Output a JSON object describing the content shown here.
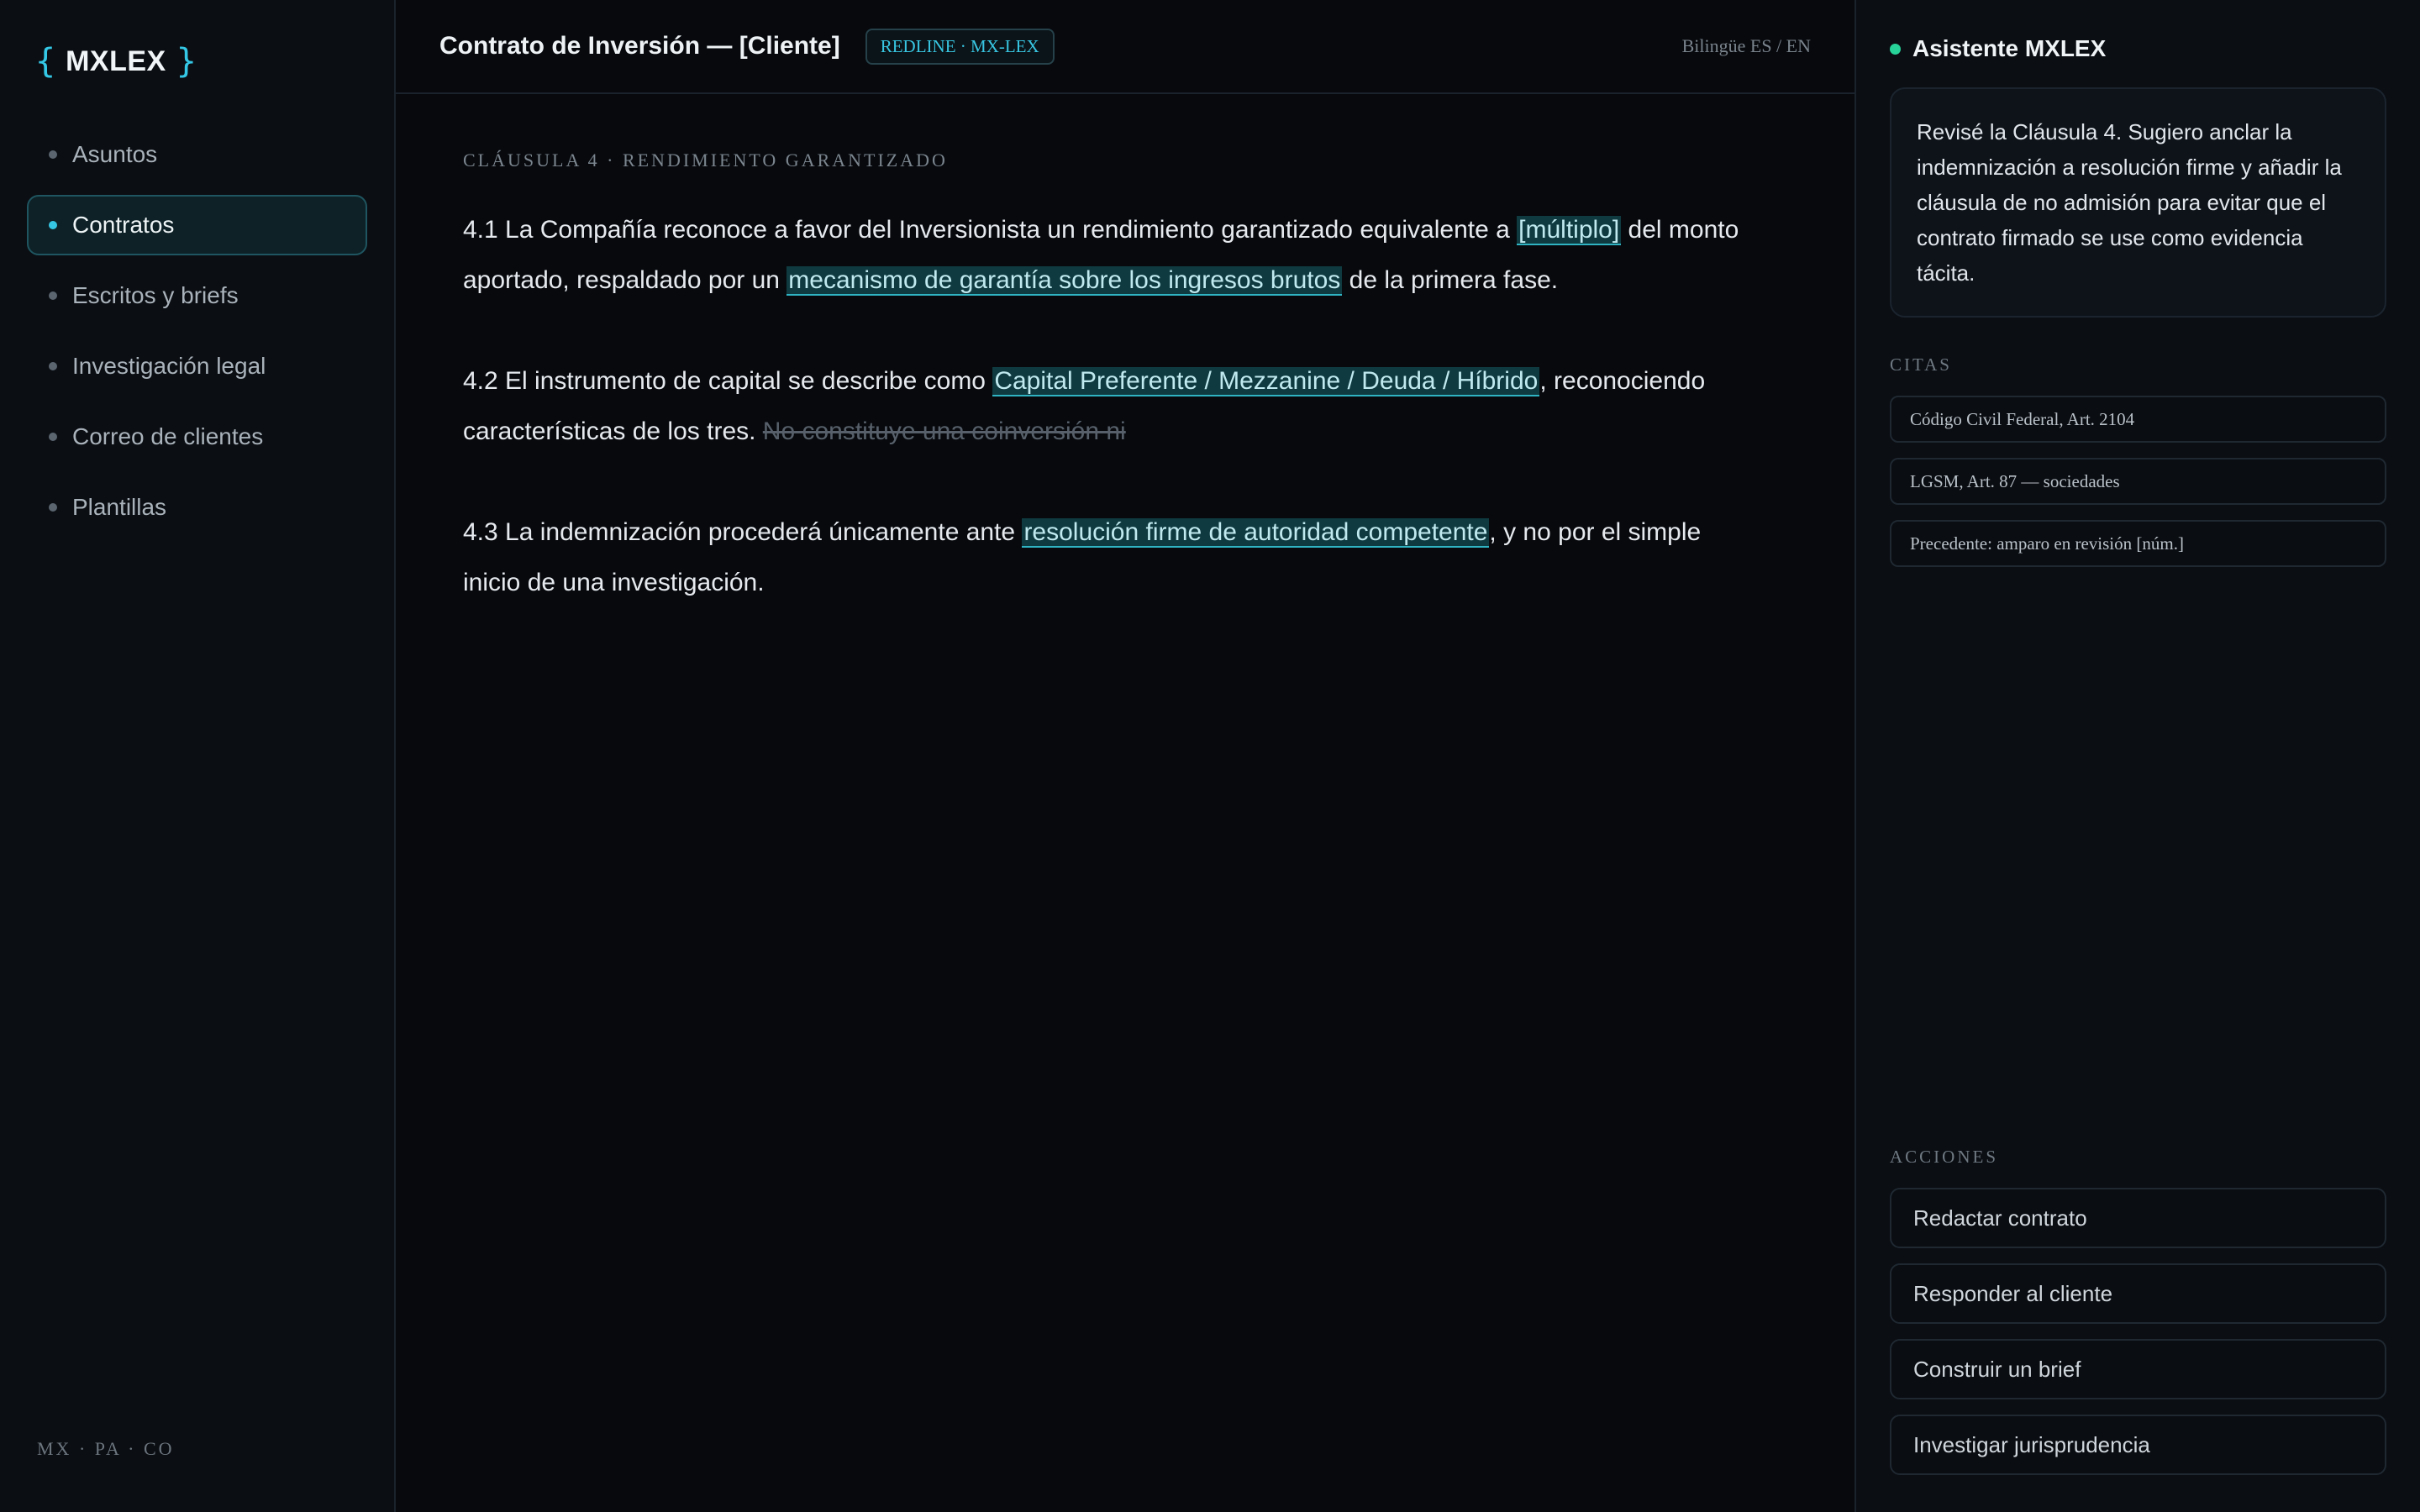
{
  "brand": {
    "left_brace": "{",
    "name": "MXLEX",
    "right_brace": "}"
  },
  "sidebar": {
    "items": [
      {
        "label": "Asuntos",
        "active": false
      },
      {
        "label": "Contratos",
        "active": true
      },
      {
        "label": "Escritos y briefs",
        "active": false
      },
      {
        "label": "Investigación legal",
        "active": false
      },
      {
        "label": "Correo de clientes",
        "active": false
      },
      {
        "label": "Plantillas",
        "active": false
      }
    ],
    "footer": "MX · PA · CO"
  },
  "header": {
    "title": "Contrato de Inversión — [Cliente]",
    "badge": "REDLINE · MX-LEX",
    "language": "Bilingüe ES / EN"
  },
  "document": {
    "clause_title": "CLÁUSULA 4 · RENDIMIENTO GARANTIZADO",
    "p1": {
      "a": "4.1 La Compañía reconoce a favor del Inversionista un rendimiento garantizado equivalente a ",
      "hl1": "[múltiplo]",
      "b": " del monto aportado, respaldado por un ",
      "hl2": "mecanismo de garantía sobre los ingresos brutos",
      "c": " de la primera fase."
    },
    "p2": {
      "a": "4.2 El instrumento de capital se describe como ",
      "hl1": "Capital Preferente / Mezzanine / Deuda / Híbrido",
      "b": ", reconociendo características de los tres. ",
      "strike": "No constituye una coinversión ni"
    },
    "p3": {
      "a": "4.3 La indemnización procederá únicamente ante ",
      "hl1": "resolución firme de autoridad competente",
      "b": ", y no por el simple inicio de una investigación."
    }
  },
  "assistant": {
    "title": "Asistente MXLEX",
    "message": "Revisé la Cláusula 4. Sugiero anclar la indemnización a resolución firme y añadir la cláusula de no admisión para evitar que el contrato firmado se use como evidencia tácita.",
    "citations_label": "CITAS",
    "citations": [
      "Código Civil Federal, Art. 2104",
      "LGSM, Art. 87 — sociedades",
      "Precedente: amparo en revisión [núm.]"
    ],
    "actions_label": "ACCIONES",
    "actions": [
      "Redactar contrato",
      "Responder al cliente",
      "Construir un brief",
      "Investigar jurisprudencia"
    ]
  },
  "colors": {
    "accent": "#33c9e6",
    "highlight_bg": "#0f3a3f",
    "status_green": "#28d39a"
  }
}
